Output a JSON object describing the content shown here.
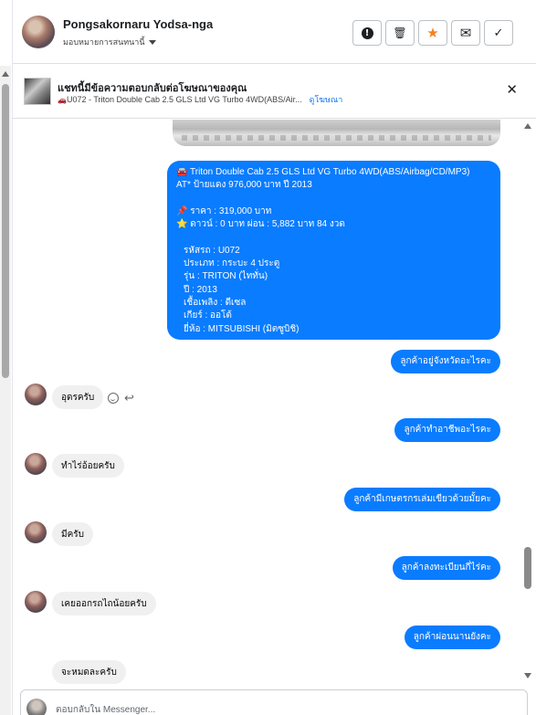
{
  "header": {
    "contact_name": "Pongsakornaru Yodsa-nga",
    "assign_label": "มอบหมายการสนทนานี้",
    "actions": [
      {
        "icon": "alert-icon",
        "glyph": "!",
        "name": "mark-spam-button"
      },
      {
        "icon": "trash-icon",
        "glyph": "🗑",
        "name": "delete-button"
      },
      {
        "icon": "star-icon",
        "glyph": "★",
        "name": "star-button"
      },
      {
        "icon": "mail-icon",
        "glyph": "✉",
        "name": "mark-unread-button"
      },
      {
        "icon": "check-icon",
        "glyph": "✓",
        "name": "mark-done-button"
      }
    ]
  },
  "ad_context": {
    "title": "แชทนี้มีข้อความตอบกลับต่อโฆษณาของคุณ",
    "car_glyph": "🚗",
    "ad_name": "U072 - Triton Double Cab 2.5 GLS Ltd VG Turbo 4WD(ABS/Air...",
    "view_ad_link": "ดูโฆษณา",
    "close_glyph": "✕"
  },
  "card": {
    "lines": [
      "🚘 Triton Double Cab 2.5 GLS Ltd VG Turbo 4WD(ABS/Airbag/CD/MP3)",
      "AT* ป้ายแดง 976,000 บาท ปี 2013",
      "",
      "📌 ราคา : 319,000 บาท",
      "⭐ ดาวน์ : 0 บาท ผ่อน : 5,882 บาท 84 งวด",
      "",
      "รหัสรถ : U072",
      "ประเภท : กระบะ 4 ประตู",
      "รุ่น : TRITON (ไททั่น)",
      "ปี : 2013",
      "เชื้อเพลิง : ดีเซล",
      "เกียร์ : ออโต้",
      "ยี่ห้อ : MITSUBISHI (มิตซูบิชิ)"
    ]
  },
  "messages": {
    "out_1": "ลูกค้าอยู่จังหวัดอะไรคะ",
    "in_1": "อุดรครับ",
    "out_2": "ลูกค้าทำอาชีพอะไรคะ",
    "in_2": "ทำไร่อ้อยครับ",
    "out_3": "ลูกค้ามีเกษตรกรเล่มเขียวด้วยมั้ยคะ",
    "in_3": "มีครับ",
    "out_4": "ลูกค้าลงทะเบียนกี่ไร่คะ",
    "in_4": "เคยออกรถไถน้อยครับ",
    "out_5": "ลูกค้าผ่อนนานยังคะ",
    "in_5": "จะหมดละครับ"
  },
  "composer": {
    "placeholder": "ตอบกลับใน Messenger..."
  },
  "colors": {
    "accent_blue": "#0a7cff",
    "incoming_bubble": "#f0f0f0",
    "star_orange": "#f5811f"
  }
}
